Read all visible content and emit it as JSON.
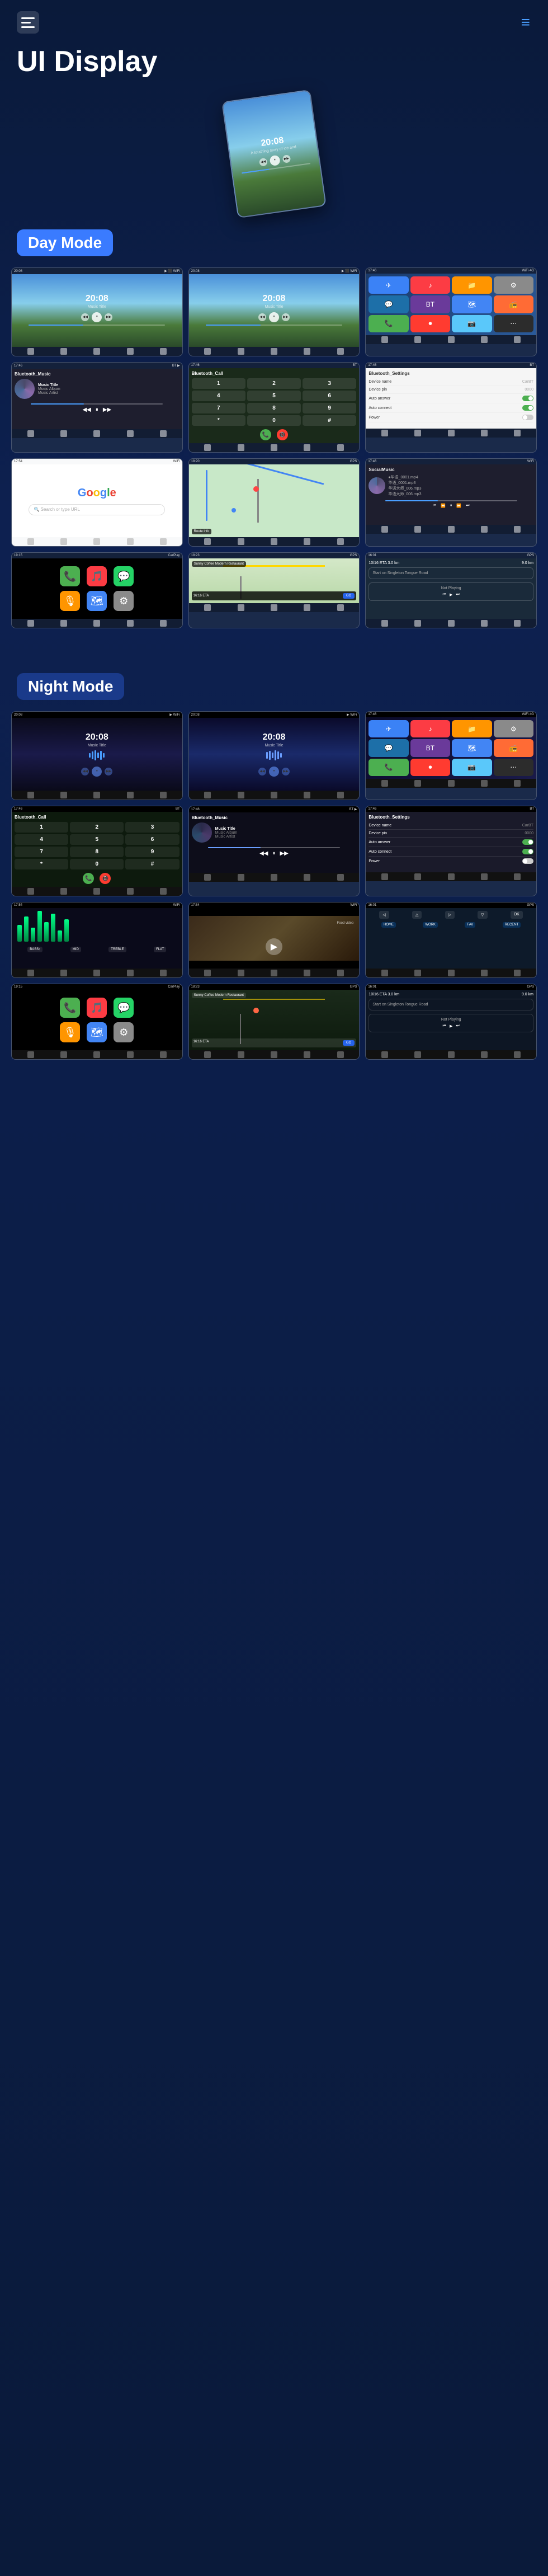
{
  "header": {
    "title": "UI Display",
    "menu_icon": "menu-icon",
    "nav_icon": "≡"
  },
  "day_mode": {
    "label": "Day Mode",
    "screens": [
      {
        "type": "music-player",
        "time": "20:08",
        "subtitle": "Music Title"
      },
      {
        "type": "music-player-2",
        "time": "20:08",
        "subtitle": "Music Title"
      },
      {
        "type": "app-grid"
      },
      {
        "type": "bluetooth-music",
        "title": "Bluetooth_Music",
        "track": "Music Title",
        "artist": "Music Album, Music Artist"
      },
      {
        "type": "bluetooth-call",
        "title": "Bluetooth_Call"
      },
      {
        "type": "bluetooth-settings",
        "title": "Bluetooth_Settings"
      },
      {
        "type": "google-search"
      },
      {
        "type": "navigation-map"
      },
      {
        "type": "social-music",
        "title": "SocialMusic"
      }
    ],
    "screens_row3": [
      {
        "type": "carplay"
      },
      {
        "type": "nav-drive"
      },
      {
        "type": "nav-notplaying"
      }
    ]
  },
  "night_mode": {
    "label": "Night Mode",
    "screens": [
      {
        "type": "night-music-1",
        "time": "20:08"
      },
      {
        "type": "night-music-2",
        "time": "20:08"
      },
      {
        "type": "night-app-grid"
      },
      {
        "type": "night-call",
        "title": "Bluetooth_Call"
      },
      {
        "type": "night-music-bt",
        "title": "Bluetooth_Music"
      },
      {
        "type": "night-settings",
        "title": "Bluetooth_Settings"
      },
      {
        "type": "night-equalizer"
      },
      {
        "type": "night-video"
      },
      {
        "type": "night-nav"
      }
    ],
    "screens_row3": [
      {
        "type": "night-carplay"
      },
      {
        "type": "night-nav-map"
      },
      {
        "type": "night-notplaying"
      }
    ]
  },
  "music": {
    "title": "Music Title",
    "album": "Music Album",
    "artist": "Music Artist"
  },
  "labels": {
    "day_mode": "Day Mode",
    "night_mode": "Night Mode",
    "ui_display": "UI Display"
  },
  "app_colors": {
    "phone": "#4CAF50",
    "messages": "#25D366",
    "music": "#fc3c44",
    "maps": "#4285f4",
    "settings": "#8a8a8a",
    "bluetooth": "#2563eb",
    "radio": "#f59e0b",
    "camera": "#6b7280"
  }
}
